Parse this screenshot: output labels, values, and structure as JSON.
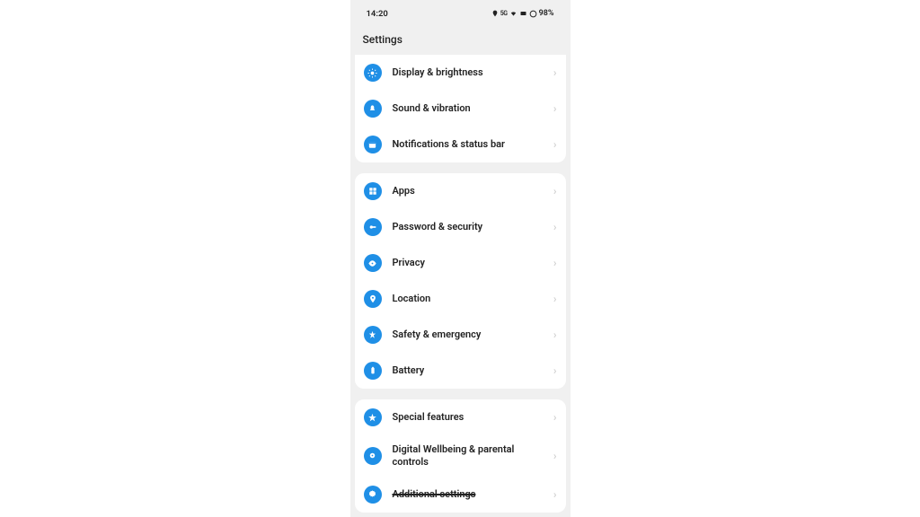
{
  "statusbar": {
    "time": "14:20",
    "battery": "98%"
  },
  "header": {
    "title": "Settings"
  },
  "groups": [
    {
      "items": [
        {
          "icon": "brightness",
          "label": "Display & brightness"
        },
        {
          "icon": "sound",
          "label": "Sound & vibration"
        },
        {
          "icon": "notifications",
          "label": "Notifications & status bar"
        }
      ]
    },
    {
      "items": [
        {
          "icon": "apps",
          "label": "Apps"
        },
        {
          "icon": "password",
          "label": "Password & security"
        },
        {
          "icon": "privacy",
          "label": "Privacy"
        },
        {
          "icon": "location",
          "label": "Location"
        },
        {
          "icon": "safety",
          "label": "Safety & emergency"
        },
        {
          "icon": "battery",
          "label": "Battery"
        }
      ]
    },
    {
      "items": [
        {
          "icon": "special",
          "label": "Special features"
        },
        {
          "icon": "wellbeing",
          "label": "Digital Wellbeing & parental controls"
        },
        {
          "icon": "additional",
          "label": "Additional settings",
          "strike": true
        }
      ]
    }
  ]
}
